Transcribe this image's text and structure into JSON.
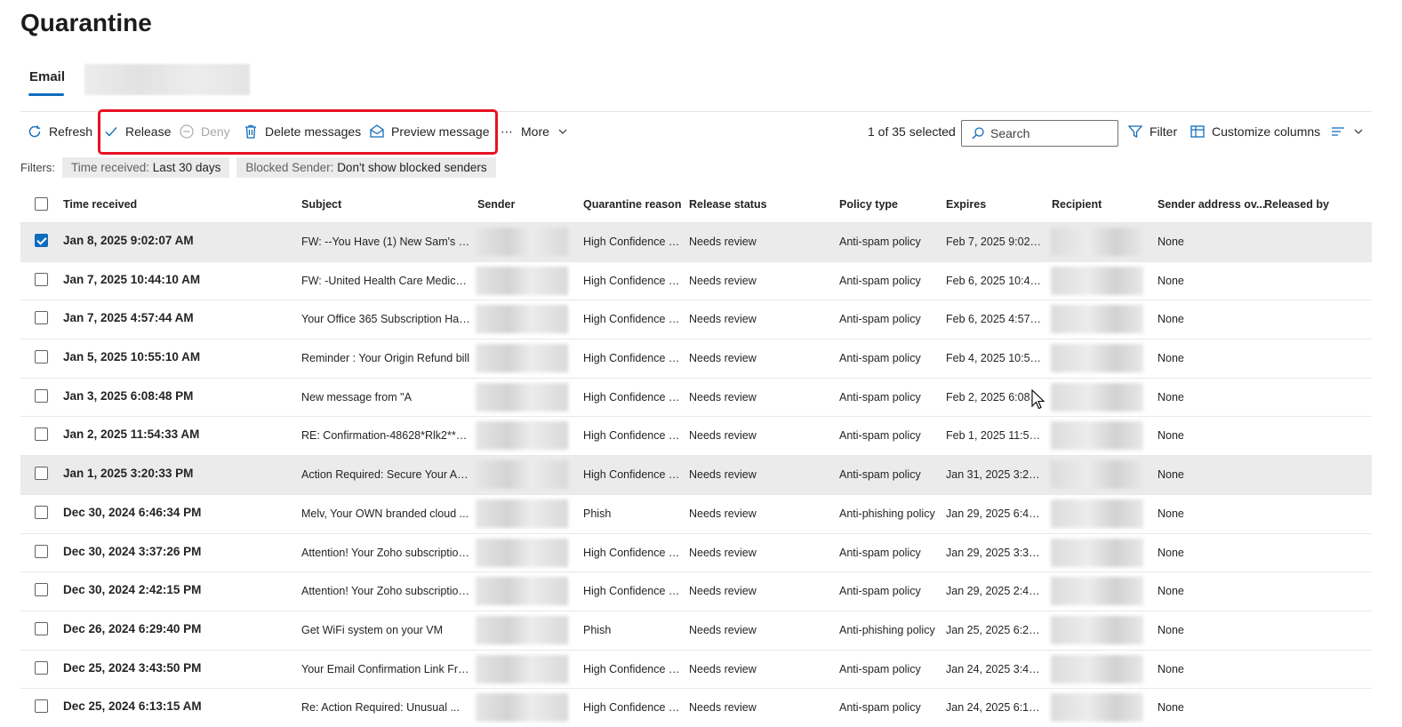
{
  "page": {
    "title": "Quarantine"
  },
  "tabs": {
    "email": "Email"
  },
  "toolbar": {
    "refresh": "Refresh",
    "release": "Release",
    "deny": "Deny",
    "delete": "Delete messages",
    "preview": "Preview message",
    "more": "More",
    "selected_count": "1 of 35 selected",
    "search_placeholder": "Search",
    "filter": "Filter",
    "customize": "Customize columns"
  },
  "filters": {
    "label": "Filters:",
    "chips": [
      {
        "key": "Time received:",
        "value": "Last 30 days"
      },
      {
        "key": "Blocked Sender:",
        "value": "Don't show blocked senders"
      }
    ]
  },
  "columns": {
    "time": "Time received",
    "subject": "Subject",
    "sender": "Sender",
    "reason": "Quarantine reason",
    "status": "Release status",
    "policy": "Policy type",
    "expires": "Expires",
    "recipient": "Recipient",
    "override": "Sender address ov...",
    "released_by": "Released by"
  },
  "rows": [
    {
      "time": "Jan 8, 2025 9:02:07 AM",
      "subject": "FW: --You Have (1) New Sam's Clu...",
      "reason": "High Confidence P...",
      "status": "Needs review",
      "policy": "Anti-spam policy",
      "expires": "Feb 7, 2025 9:02:07...",
      "override": "None",
      "checked": true
    },
    {
      "time": "Jan 7, 2025 10:44:10 AM",
      "subject": "FW: -United Health Care Medicare...",
      "reason": "High Confidence P...",
      "status": "Needs review",
      "policy": "Anti-spam policy",
      "expires": "Feb 6, 2025 10:44:1...",
      "override": "None"
    },
    {
      "time": "Jan 7, 2025 4:57:44 AM",
      "subject": "Your Office 365 Subscription Has ...",
      "reason": "High Confidence P...",
      "status": "Needs review",
      "policy": "Anti-spam policy",
      "expires": "Feb 6, 2025 4:57:44...",
      "override": "None"
    },
    {
      "time": "Jan 5, 2025 10:55:10 AM",
      "subject": "Reminder : Your Origin Refund bill",
      "reason": "High Confidence P...",
      "status": "Needs review",
      "policy": "Anti-spam policy",
      "expires": "Feb 4, 2025 10:55:1...",
      "override": "None"
    },
    {
      "time": "Jan 3, 2025 6:08:48 PM",
      "subject": "New message from \"A",
      "reason": "High Confidence P...",
      "status": "Needs review",
      "policy": "Anti-spam policy",
      "expires": "Feb 2, 2025 6:08:48...",
      "override": "None"
    },
    {
      "time": "Jan 2, 2025 11:54:33 AM",
      "subject": "RE: Confirmation-48628*Rlk2**-wt...",
      "reason": "High Confidence P...",
      "status": "Needs review",
      "policy": "Anti-spam policy",
      "expires": "Feb 1, 2025 11:54:3...",
      "override": "None"
    },
    {
      "time": "Jan 1, 2025 3:20:33 PM",
      "subject": "Action Required: Secure Your Acco...",
      "reason": "High Confidence P...",
      "status": "Needs review",
      "policy": "Anti-spam policy",
      "expires": "Jan 31, 2025 3:20:3...",
      "override": "None",
      "hover": true
    },
    {
      "time": "Dec 30, 2024 6:46:34 PM",
      "subject": "Melv, Your OWN branded cloud ...",
      "reason": "Phish",
      "status": "Needs review",
      "policy": "Anti-phishing policy",
      "expires": "Jan 29, 2025 6:46:3...",
      "override": "None"
    },
    {
      "time": "Dec 30, 2024 3:37:26 PM",
      "subject": "Attention! Your Zoho subscription ...",
      "reason": "High Confidence P...",
      "status": "Needs review",
      "policy": "Anti-spam policy",
      "expires": "Jan 29, 2025 3:37:2...",
      "override": "None"
    },
    {
      "time": "Dec 30, 2024 2:42:15 PM",
      "subject": "Attention! Your Zoho subscription ...",
      "reason": "High Confidence P...",
      "status": "Needs review",
      "policy": "Anti-spam policy",
      "expires": "Jan 29, 2025 2:42:1...",
      "override": "None"
    },
    {
      "time": "Dec 26, 2024 6:29:40 PM",
      "subject": "Get WiFi system on your VM",
      "reason": "Phish",
      "status": "Needs review",
      "policy": "Anti-phishing policy",
      "expires": "Jan 25, 2025 6:29:4...",
      "override": "None"
    },
    {
      "time": "Dec 25, 2024 3:43:50 PM",
      "subject": "Your Email Confirmation Link Fro...",
      "reason": "High Confidence P...",
      "status": "Needs review",
      "policy": "Anti-spam policy",
      "expires": "Jan 24, 2025 3:43:5...",
      "override": "None"
    },
    {
      "time": "Dec 25, 2024 6:13:15 AM",
      "subject": "Re: Action Required: Unusual ...",
      "reason": "High Confidence P...",
      "status": "Needs review",
      "policy": "Anti-spam policy",
      "expires": "Jan 24, 2025 6:13:1...",
      "override": "None"
    }
  ]
}
